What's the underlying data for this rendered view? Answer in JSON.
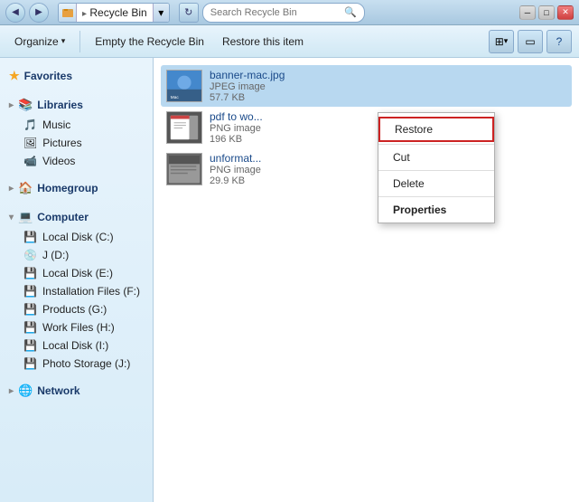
{
  "window": {
    "title": "Recycle Bin",
    "min_btn": "─",
    "max_btn": "□",
    "close_btn": "✕"
  },
  "titlebar": {
    "back_label": "◀",
    "forward_label": "▶",
    "address": "Recycle Bin",
    "dropdown": "▾",
    "refresh": "↻",
    "search_placeholder": "Search Recycle Bin",
    "search_icon": "🔍"
  },
  "toolbar": {
    "organize_label": "Organize",
    "empty_label": "Empty the Recycle Bin",
    "restore_label": "Restore this item",
    "view_icon": "⊞",
    "help_icon": "?"
  },
  "sidebar": {
    "favorites_label": "Favorites",
    "libraries_label": "Libraries",
    "music_label": "Music",
    "pictures_label": "Pictures",
    "videos_label": "Videos",
    "homegroup_label": "Homegroup",
    "computer_label": "Computer",
    "local_c_label": "Local Disk (C:)",
    "j_label": "J (D:)",
    "local_e_label": "Local Disk (E:)",
    "install_label": "Installation Files (F:)",
    "products_label": "Products (G:)",
    "work_label": "Work Files (H:)",
    "local_i_label": "Local Disk (I:)",
    "photo_label": "Photo Storage (J:)",
    "network_label": "Network"
  },
  "files": [
    {
      "name": "banner-mac.jpg",
      "type": "JPEG image",
      "size": "57.7 KB",
      "thumb_type": "banner"
    },
    {
      "name": "pdf to wo...",
      "type": "PNG image",
      "size": "196 KB",
      "thumb_type": "pdf"
    },
    {
      "name": "unformat...",
      "type": "PNG image",
      "size": "29.9 KB",
      "thumb_type": "unformat"
    }
  ],
  "context_menu": {
    "restore_label": "Restore",
    "cut_label": "Cut",
    "delete_label": "Delete",
    "properties_label": "Properties"
  },
  "status_bar": {
    "text": ""
  }
}
